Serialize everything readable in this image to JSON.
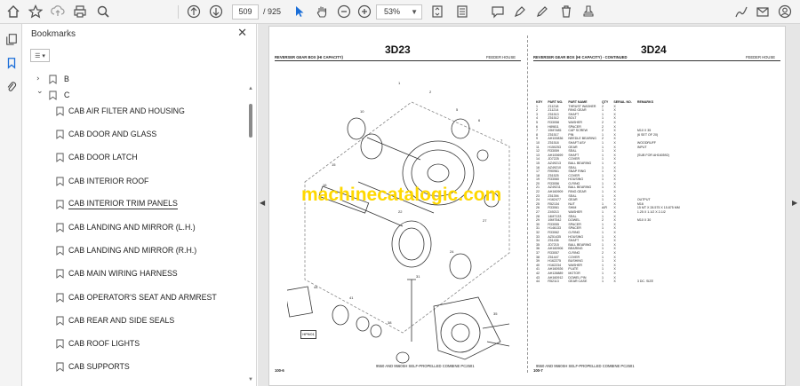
{
  "toolbar": {
    "page_current": "509",
    "page_total": "/ 925",
    "zoom": "53%",
    "icons": [
      "home-icon",
      "star-icon",
      "upload-icon",
      "print-icon",
      "search-icon",
      "prev-page-icon",
      "next-page-icon",
      "cursor-icon",
      "hand-icon",
      "zoom-out-icon",
      "zoom-in-icon",
      "fit-icon",
      "scroll-icon",
      "comment-icon",
      "highlight-icon",
      "delete-icon",
      "stamp-icon",
      "sign-icon",
      "mail-icon",
      "profile-icon"
    ]
  },
  "panel": {
    "title": "Bookmarks",
    "items": [
      {
        "label": "B",
        "type": "group",
        "expanded": false
      },
      {
        "label": "C",
        "type": "group",
        "expanded": true
      },
      {
        "label": "CAB AIR FILTER AND HOUSING"
      },
      {
        "label": "CAB DOOR AND GLASS"
      },
      {
        "label": "CAB DOOR LATCH"
      },
      {
        "label": "CAB INTERIOR ROOF"
      },
      {
        "label": "CAB INTERIOR TRIM PANELS"
      },
      {
        "label": "CAB LANDING AND MIRROR (L.H.)"
      },
      {
        "label": "CAB LANDING AND MIRROR (R.H.)"
      },
      {
        "label": "CAB MAIN WIRING HARNESS"
      },
      {
        "label": "CAB OPERATOR'S SEAT AND ARMREST"
      },
      {
        "label": "CAB REAR AND SIDE SEALS"
      },
      {
        "label": "CAB ROOF LIGHTS"
      },
      {
        "label": "CAB SUPPORTS"
      }
    ]
  },
  "document": {
    "watermark": "machinecatalogic.com",
    "left": {
      "title": "3D23",
      "header": "REVERSER GEAR BOX (HI CAPACITY)",
      "section": "FEEDER HOUSE",
      "figure_id": "HP9/01",
      "page_no": "100-6",
      "footer": "9550 AND 9560SH SELF-PROPELLED COMBINE PC2501"
    },
    "right": {
      "title": "3D24",
      "header": "REVERSER GEAR BOX (HI CAPACITY) - CONTINUED",
      "section": "FEEDER HOUSE",
      "page_no": "100-7",
      "footer": "9550 AND 9560SH SELF-PROPELLED COMBINE PC2501",
      "columns": [
        "KEY",
        "PART NO.",
        "PART NAME",
        "QTY",
        "SERIAL NO.",
        "REMARKS"
      ],
      "rows": [
        [
          "1",
          "Z11218",
          "THRUST WASHER",
          "2",
          "X",
          ""
        ],
        [
          "2",
          "Z11214",
          "RING GEAR",
          "1",
          "X",
          ""
        ],
        [
          "3",
          "Z51513",
          "SHAFT",
          "1",
          "X",
          ""
        ],
        [
          "4",
          "Z51512",
          "BOLT",
          "1",
          "X",
          ""
        ],
        [
          "5",
          "R33058",
          "WASHER",
          "2",
          "X",
          ""
        ],
        [
          "6",
          "H89811",
          "SPACER",
          "2",
          "X",
          ""
        ],
        [
          "7",
          "19M7485",
          "CAP SCREW",
          "2",
          "X",
          "M10 X 35"
        ],
        [
          "8",
          "Z51517",
          "PIN",
          "1",
          "X",
          "(6 SET OF 20)"
        ],
        [
          "9",
          "AH100836",
          "NEEDLE BEARING",
          "2",
          "X",
          ""
        ],
        [
          "10",
          "Z51518",
          "SHAFT ASY",
          "1",
          "X",
          "WOODRUFF"
        ],
        [
          "11",
          "H150253",
          "GEAR",
          "1",
          "X",
          "INPUT"
        ],
        [
          "12",
          "R33059",
          "SEAL",
          "1",
          "X",
          ""
        ],
        [
          "13",
          "AH100699",
          "SHAFT",
          "1",
          "X",
          "(SUB FOR AH160592)"
        ],
        [
          "14",
          "JD7225",
          "COVER",
          "1",
          "X",
          ""
        ],
        [
          "15",
          "AZ49213",
          "BALL BEARING",
          "1",
          "X",
          ""
        ],
        [
          "16",
          "AZ49210",
          "SEAL",
          "1",
          "X",
          ""
        ],
        [
          "17",
          "R90961",
          "SNAP RING",
          "1",
          "X",
          ""
        ],
        [
          "18",
          "Z51525",
          "COVER",
          "1",
          "X",
          ""
        ],
        [
          "19",
          "R33060",
          "HOUSING",
          "1",
          "X",
          ""
        ],
        [
          "20",
          "R33056",
          "O-RING",
          "1",
          "X",
          ""
        ],
        [
          "21",
          "AZ49211",
          "BALL BEARING",
          "1",
          "X",
          ""
        ],
        [
          "22",
          "AH160909",
          "RING GEAR",
          "1",
          "X",
          ""
        ],
        [
          "23",
          "Z51394",
          "SEAL",
          "1",
          "X",
          ""
        ],
        [
          "24",
          "H162477",
          "GEAR",
          "1",
          "X",
          "OUTPUT"
        ],
        [
          "25",
          "R52134",
          "NUT",
          "1",
          "X",
          "M16"
        ],
        [
          "26",
          "R33061",
          "SHIM",
          "A/R",
          "X",
          "15 MT X 28.575 X 15.875 MM"
        ],
        [
          "27",
          "Z49213",
          "WASHER",
          "1",
          "X",
          "1.25 X 1.1/2 X 2-1/2"
        ],
        [
          "28",
          "14M7133",
          "SEAL",
          "1",
          "X",
          ""
        ],
        [
          "29",
          "19M7542",
          "DOWEL",
          "2",
          "X",
          "M10 X 30"
        ],
        [
          "30",
          "R33055",
          "SPACER",
          "1",
          "X",
          ""
        ],
        [
          "31",
          "H146133",
          "SPACER",
          "1",
          "X",
          ""
        ],
        [
          "32",
          "R33062",
          "O-RING",
          "1",
          "X",
          ""
        ],
        [
          "33",
          "AZ51435",
          "HOUSING",
          "1",
          "X",
          ""
        ],
        [
          "34",
          "Z51436",
          "SHAFT",
          "1",
          "X",
          ""
        ],
        [
          "35",
          "JD7215",
          "BALL BEARING",
          "1",
          "X",
          ""
        ],
        [
          "36",
          "AH160906",
          "BEARING",
          "1",
          "X",
          ""
        ],
        [
          "37",
          "R33057",
          "O-RING",
          "2",
          "X",
          ""
        ],
        [
          "38",
          "Z51447",
          "COVER",
          "1",
          "X",
          ""
        ],
        [
          "39",
          "H162275",
          "BUSHING",
          "1",
          "X",
          ""
        ],
        [
          "40",
          "H162234",
          "WASHER",
          "1",
          "X",
          ""
        ],
        [
          "41",
          "AH160926",
          "PLATE",
          "1",
          "X",
          ""
        ],
        [
          "42",
          "AH126889",
          "MOTOR",
          "1",
          "X",
          ""
        ],
        [
          "43",
          "AH160912",
          "DOWEL PIN",
          "1",
          "X",
          ""
        ],
        [
          "44",
          "R52113",
          "GEAR CASE",
          "1",
          "X",
          "3 DC. SIZE"
        ]
      ]
    }
  },
  "colors": {
    "watermark": "#ffd800",
    "toolbar_bg": "#f4f4f4",
    "viewer_bg": "#e6e6e6",
    "accent": "#1a6ed8"
  }
}
